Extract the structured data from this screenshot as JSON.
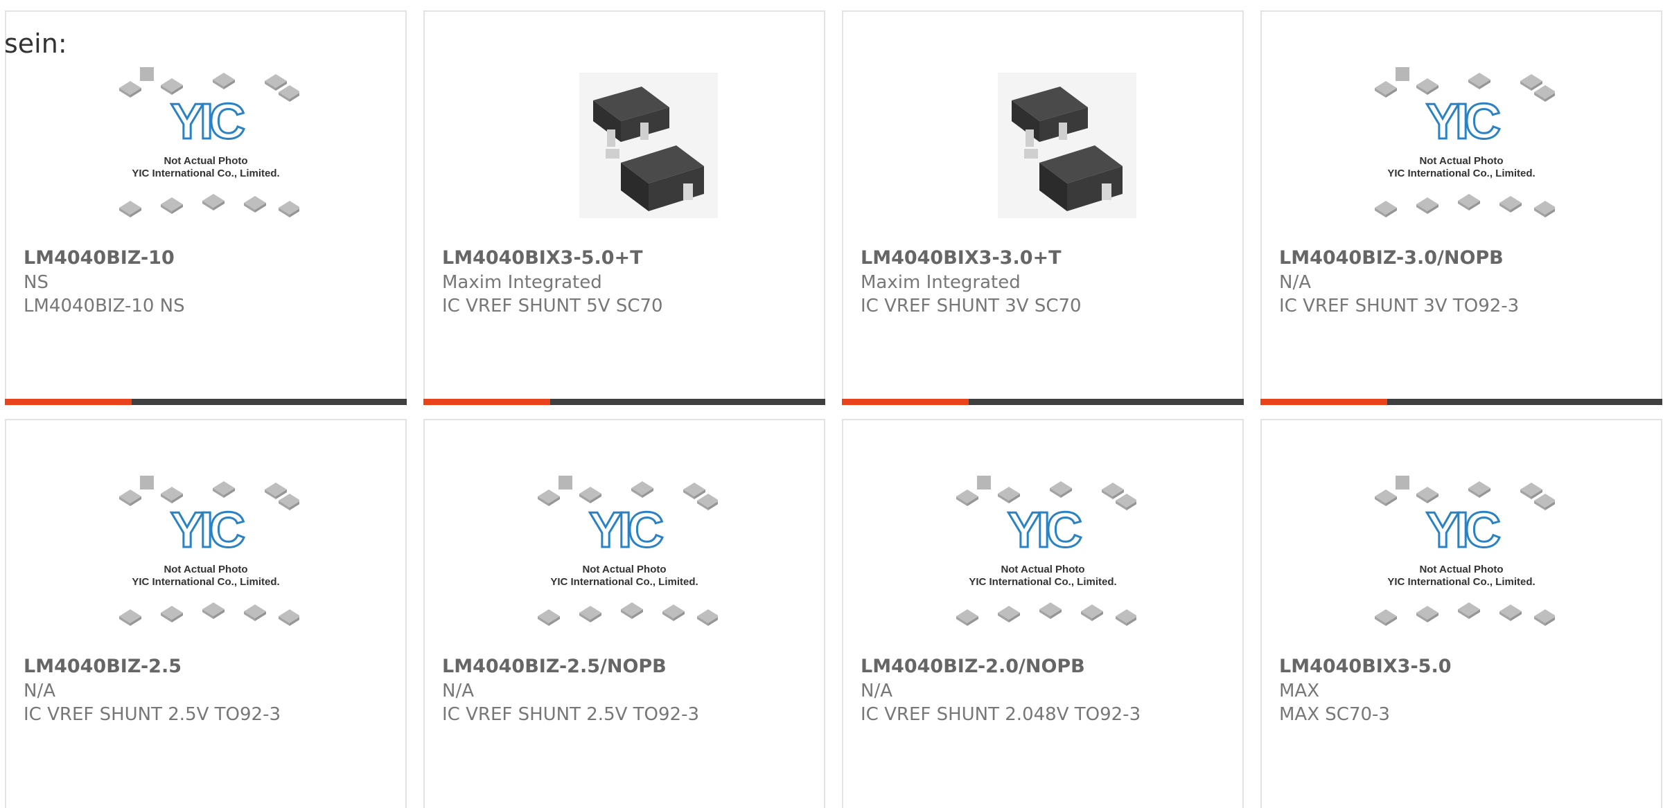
{
  "page": {
    "lead_text": "sein:"
  },
  "colors": {
    "accent": "#e8431a",
    "bar_dark": "#3f3f3f",
    "card_border": "#e3e3e3",
    "logo_blue": "#2a82c4"
  },
  "placeholder_image": {
    "icon": "yic-placeholder-image",
    "caption_line1": "Not Actual Photo",
    "caption_line2": "YIC International Co., Limited."
  },
  "products": [
    {
      "part_number": "LM4040BIZ-10",
      "manufacturer": "NS",
      "description": "LM4040BIZ-10 NS",
      "image": "yic-placeholder",
      "accent_bar": true
    },
    {
      "part_number": "LM4040BIX3-5.0+T",
      "manufacturer": "Maxim Integrated",
      "description": "IC VREF SHUNT 5V SC70",
      "image": "sc70-package-photo",
      "accent_bar": true
    },
    {
      "part_number": "LM4040BIX3-3.0+T",
      "manufacturer": "Maxim Integrated",
      "description": "IC VREF SHUNT 3V SC70",
      "image": "sc70-package-photo",
      "accent_bar": true
    },
    {
      "part_number": "LM4040BIZ-3.0/NOPB",
      "manufacturer": "N/A",
      "description": "IC VREF SHUNT 3V TO92-3",
      "image": "yic-placeholder",
      "accent_bar": true
    },
    {
      "part_number": "LM4040BIZ-2.5",
      "manufacturer": "N/A",
      "description": "IC VREF SHUNT 2.5V TO92-3",
      "image": "yic-placeholder",
      "accent_bar": false
    },
    {
      "part_number": "LM4040BIZ-2.5/NOPB",
      "manufacturer": "N/A",
      "description": "IC VREF SHUNT 2.5V TO92-3",
      "image": "yic-placeholder",
      "accent_bar": false
    },
    {
      "part_number": "LM4040BIZ-2.0/NOPB",
      "manufacturer": "N/A",
      "description": "IC VREF SHUNT 2.048V TO92-3",
      "image": "yic-placeholder",
      "accent_bar": false
    },
    {
      "part_number": "LM4040BIX3-5.0",
      "manufacturer": "MAX",
      "description": "MAX SC70-3",
      "image": "yic-placeholder",
      "accent_bar": false
    }
  ]
}
